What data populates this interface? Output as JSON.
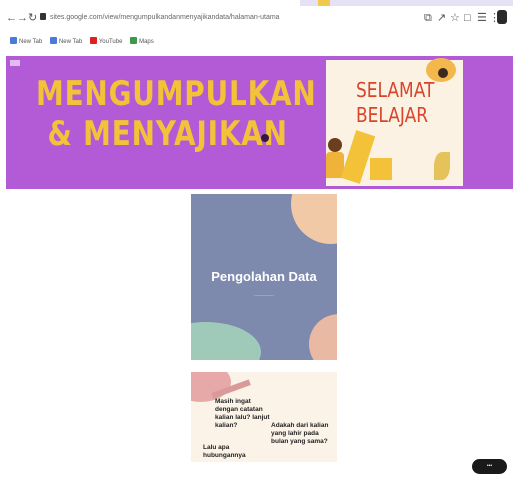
{
  "browser": {
    "back_icon": "arrow-left-icon",
    "forward_icon": "arrow-right-icon",
    "reload_icon": "reload-icon",
    "url": "sites.google.com/view/mengumpulkandanmenyajikandata/halaman-utama",
    "bookmarks": [
      {
        "label": "New Tab",
        "color": "#4a7bd6"
      },
      {
        "label": "New Tab",
        "color": "#4a7bd6"
      },
      {
        "label": "YouTube",
        "color": "#e02020"
      },
      {
        "label": "Maps",
        "color": "#3a9a4a"
      }
    ]
  },
  "banner": {
    "title_line1": "MENGUMPULKAN",
    "title_line2": "& MENYAJIKAN",
    "card_line1": "SELAMAT",
    "card_line2": "BELAJAR",
    "background_color": "#b35bd6",
    "title_color": "#f3c238"
  },
  "slide1": {
    "title": "Pengolahan Data"
  },
  "slide2": {
    "q1": "Masih ingat dengan catatan kalian lalu? lanjut kalian?",
    "q2": "Adakah dari kalian yang lahir pada bulan yang sama?",
    "q3": "Lalu apa hubungannya"
  }
}
